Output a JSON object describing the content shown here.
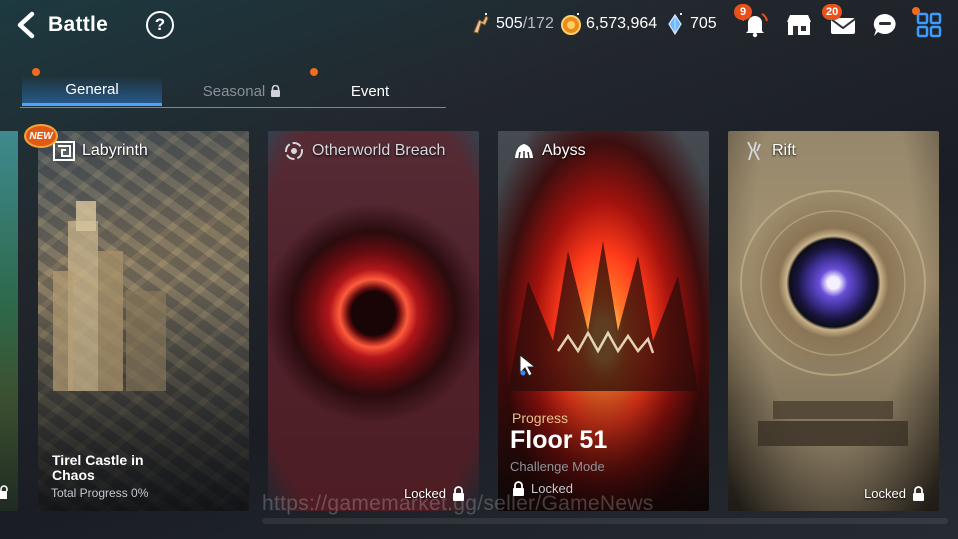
{
  "header": {
    "title": "Battle",
    "help_label": "?"
  },
  "resources": {
    "stamina_value": "505",
    "stamina_max": "/172",
    "gold": "6,573,964",
    "skystone": "705"
  },
  "notifications": {
    "bell_count": "9",
    "mail_count": "20"
  },
  "tabs": [
    {
      "label": "General",
      "state": "active"
    },
    {
      "label": "Seasonal",
      "state": "locked"
    },
    {
      "label": "Event",
      "state": "normal"
    }
  ],
  "cards": {
    "labyrinth": {
      "title": "Labyrinth",
      "new_label": "NEW",
      "subtitle": "Tirel Castle in Chaos",
      "progress": "Total Progress 0%"
    },
    "otherworld": {
      "title": "Otherworld Breach",
      "status": "Locked"
    },
    "abyss": {
      "title": "Abyss",
      "progress_label": "Progress",
      "floor": "Floor 51",
      "mode": "Challenge Mode",
      "status": "Locked"
    },
    "rift": {
      "title": "Rift",
      "status": "Locked"
    }
  },
  "watermark": "https://gamemarket.gg/seller/GameNews",
  "colors": {
    "accent": "#4aa3ff",
    "notification": "#e8511b",
    "abyss_glow": "#ff3a1a",
    "breach_red": "#c8171c",
    "rift_portal": "#3a2f8f"
  }
}
